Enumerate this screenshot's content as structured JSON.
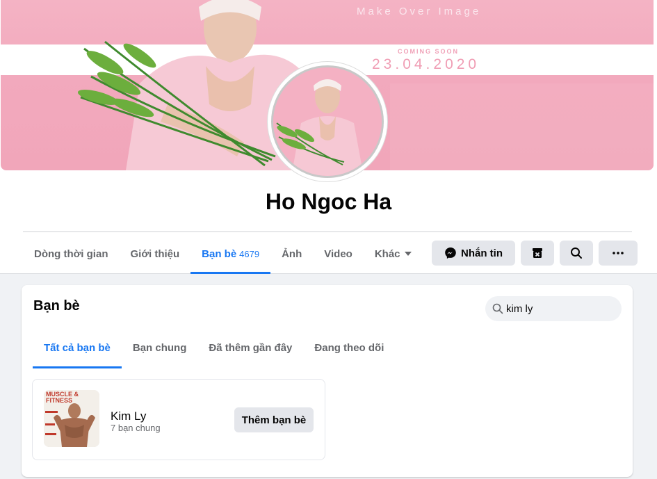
{
  "cover": {
    "tagline": "Make Over Image",
    "coming": "COMING SOON",
    "date": "23.04.2020"
  },
  "profile": {
    "name": "Ho Ngoc Ha"
  },
  "nav": {
    "tabs": [
      {
        "label": "Dòng thời gian"
      },
      {
        "label": "Giới thiệu"
      },
      {
        "label": "Bạn bè",
        "count": "4679",
        "active": true
      },
      {
        "label": "Ảnh"
      },
      {
        "label": "Video"
      },
      {
        "label": "Khác"
      }
    ],
    "actions": {
      "message_label": "Nhắn tin"
    }
  },
  "friends": {
    "title": "Bạn bè",
    "search": {
      "value": "kim ly"
    },
    "tabs": [
      {
        "label": "Tất cả bạn bè",
        "active": true
      },
      {
        "label": "Bạn chung"
      },
      {
        "label": "Đã thêm gần đây"
      },
      {
        "label": "Đang theo dõi"
      }
    ],
    "results": [
      {
        "name": "Kim Ly",
        "mutual": "7 bạn chung",
        "add_label": "Thêm bạn bè",
        "photo_text": "MUSCLE & FITNESS"
      }
    ]
  },
  "colors": {
    "accent": "#1877f2",
    "cover_pink": "#f2a9bd",
    "button_gray": "#e4e6eb"
  }
}
